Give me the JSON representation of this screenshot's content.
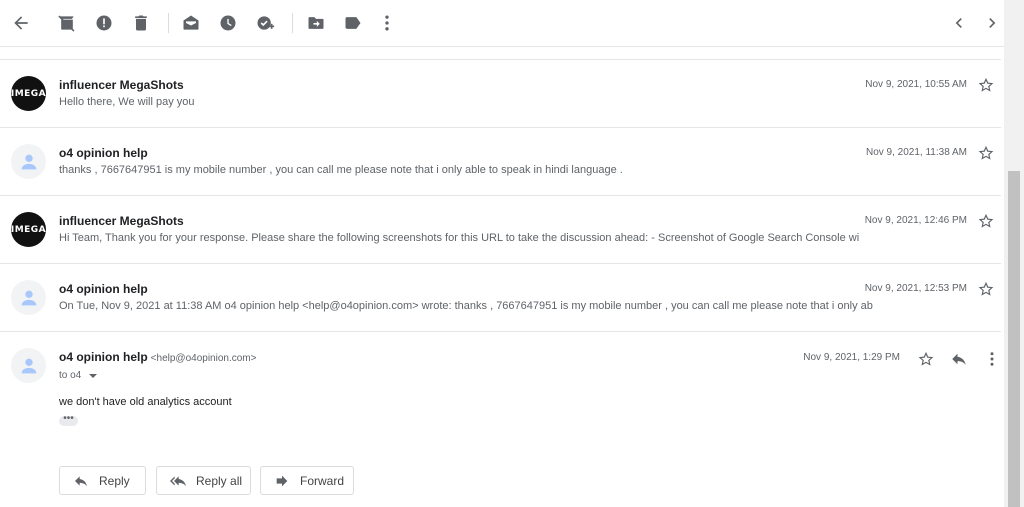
{
  "toolbar": {
    "icons": [
      "back-arrow-icon",
      "archive-icon",
      "report-spam-icon",
      "delete-icon",
      "mark-unread-icon",
      "snooze-icon",
      "add-task-icon",
      "move-to-icon",
      "labels-icon",
      "more-vert-icon"
    ],
    "nav": [
      "chevron-left-icon",
      "chevron-right-icon"
    ]
  },
  "messages": [
    {
      "sender": "influencer MegaShots",
      "avatar": "logo",
      "avatar_text": "IMEGA",
      "snippet": "Hello there, We will pay you",
      "date": "Nov 9, 2021, 10:55 AM"
    },
    {
      "sender": "o4 opinion help",
      "avatar": "default",
      "snippet": "thanks , 7667647951 is my mobile number , you can call me please note that i only able to speak in hindi language .",
      "date": "Nov 9, 2021, 11:38 AM"
    },
    {
      "sender": "influencer MegaShots",
      "avatar": "logo",
      "avatar_text": "IMEGA",
      "snippet": "Hi Team, Thank you for your response. Please share the following screenshots for this URL to take the discussion ahead: - Screenshot of Google Search Console wi",
      "date": "Nov 9, 2021, 12:46 PM"
    },
    {
      "sender": "o4 opinion help",
      "avatar": "default",
      "snippet": "On Tue, Nov 9, 2021 at 11:38 AM o4 opinion help <help@o4opinion.com> wrote: thanks , 7667647951 is my mobile number , you can call me please note that i only ab",
      "date": "Nov 9, 2021, 12:53 PM"
    }
  ],
  "open_message": {
    "sender": "o4 opinion help",
    "email": "<help@o4opinion.com>",
    "to": "to o4",
    "date": "Nov 9, 2021, 1:29 PM",
    "body": "we don't have old analytics account",
    "ellipsis": "•••"
  },
  "actions": {
    "reply": "Reply",
    "reply_all": "Reply all",
    "forward": "Forward"
  }
}
